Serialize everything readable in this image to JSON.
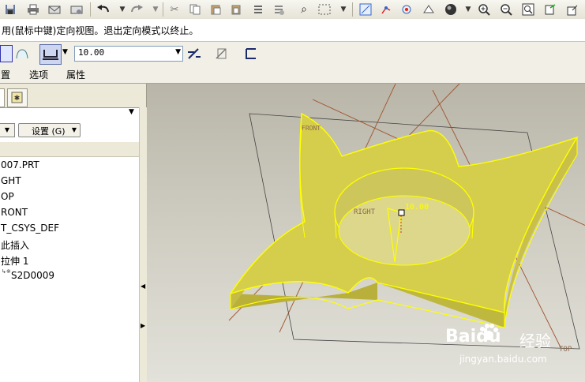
{
  "message": {
    "text": "用(鼠标中键)定向视图。退出定向模式以终止。"
  },
  "dashboard": {
    "depth_value": "10.00"
  },
  "tabs": [
    "置",
    "选项",
    "属性"
  ],
  "model_tree": {
    "settings_button": "设置 (G)",
    "items": [
      "007.PRT",
      "GHT",
      "OP",
      "RONT",
      "T_CSYS_DEF",
      "此插入",
      "拉伸 1",
      "S2D0009"
    ]
  },
  "viewport": {
    "labels": {
      "front": "FRONT",
      "right": "RIGHT",
      "top": "TOP",
      "dimension": "10.00"
    },
    "model_color": "#d8d04a",
    "edge_color": "#ffff00"
  },
  "watermark": {
    "logo_text": "Baidu",
    "jingyan": "经验",
    "url": "jingyan.baidu.com"
  },
  "icons": [
    "save-icon",
    "print-icon",
    "undo-icon",
    "redo-icon",
    "cut-icon",
    "copy-icon",
    "paste-icon",
    "find-icon",
    "select-box-icon",
    "spin-center-icon",
    "datum-icon",
    "shade-icon",
    "zoom-in-icon",
    "zoom-out-icon",
    "refit-icon"
  ]
}
